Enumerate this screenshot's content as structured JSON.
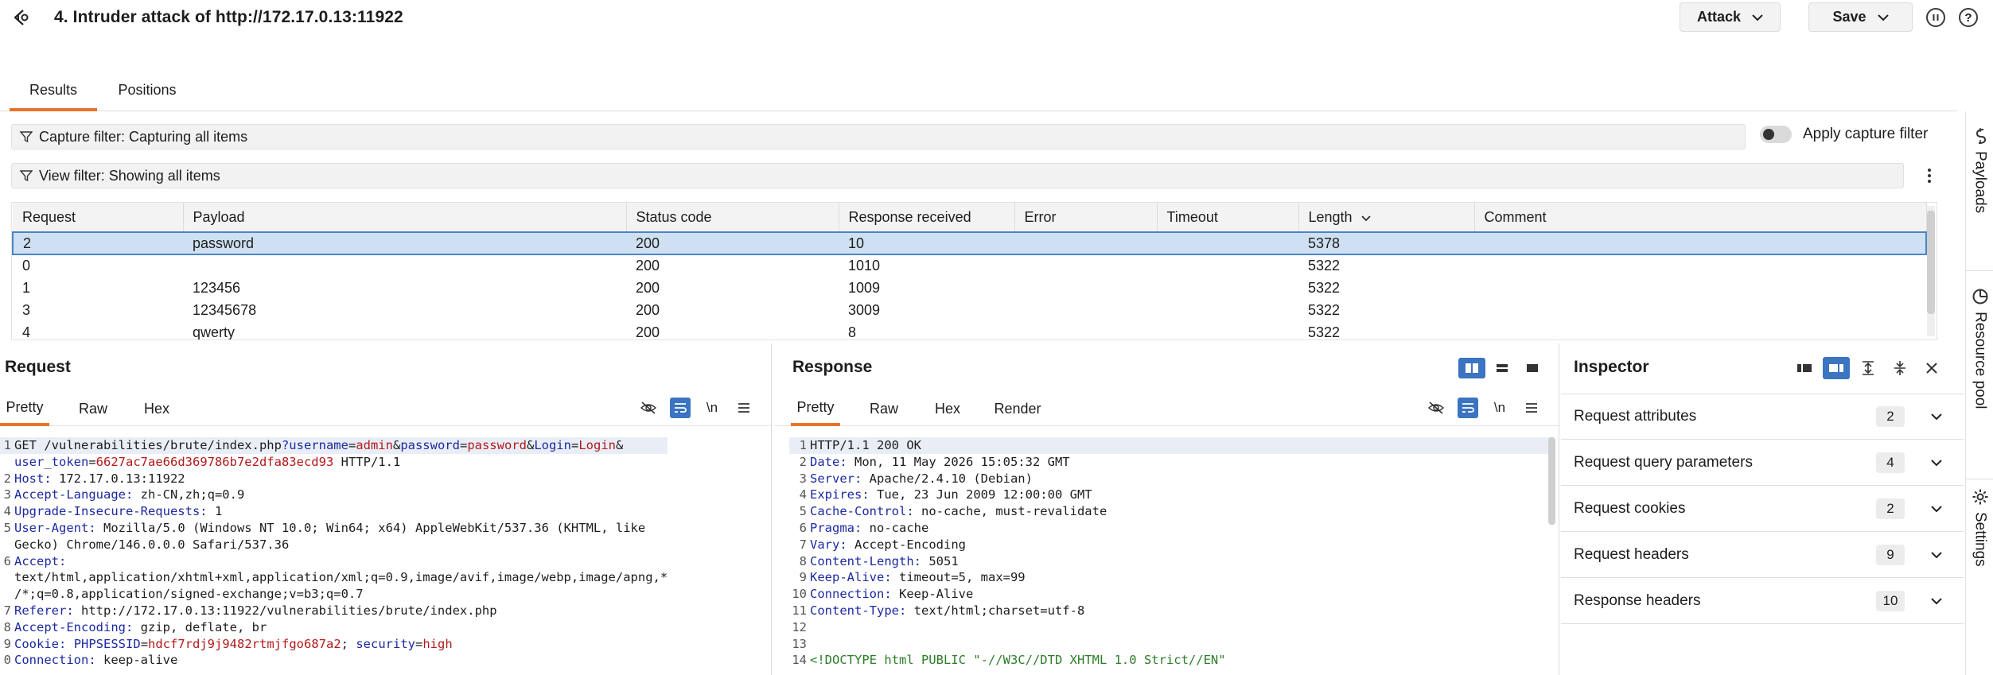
{
  "header": {
    "title": "4. Intruder attack of http://172.17.0.13:11922",
    "attack_label": "Attack",
    "save_label": "Save",
    "help_label": "?"
  },
  "tabs": [
    {
      "label": "Results",
      "active": true
    },
    {
      "label": "Positions",
      "active": false
    }
  ],
  "filters": {
    "capture": "Capture filter: Capturing all items",
    "view": "View filter: Showing all items",
    "apply_capture_label": "Apply capture filter",
    "apply_capture_enabled": false
  },
  "results": {
    "columns": [
      "Request",
      "Payload",
      "Status code",
      "Response received",
      "Error",
      "Timeout",
      "Length",
      "Comment"
    ],
    "sort_column": "Length",
    "rows": [
      {
        "request": "2",
        "payload": "password",
        "status": "200",
        "received": "10",
        "error": "",
        "timeout": "",
        "length": "5378",
        "comment": "",
        "selected": true
      },
      {
        "request": "0",
        "payload": "",
        "status": "200",
        "received": "1010",
        "error": "",
        "timeout": "",
        "length": "5322",
        "comment": ""
      },
      {
        "request": "1",
        "payload": "123456",
        "status": "200",
        "received": "1009",
        "error": "",
        "timeout": "",
        "length": "5322",
        "comment": ""
      },
      {
        "request": "3",
        "payload": "12345678",
        "status": "200",
        "received": "3009",
        "error": "",
        "timeout": "",
        "length": "5322",
        "comment": ""
      },
      {
        "request": "4",
        "payload": "qwerty",
        "status": "200",
        "received": "8",
        "error": "",
        "timeout": "",
        "length": "5322",
        "comment": ""
      }
    ]
  },
  "request_pane": {
    "title": "Request",
    "tabs": [
      "Pretty",
      "Raw",
      "Hex"
    ],
    "newline_label": "\\n",
    "line1": {
      "method_path": "GET /vulnerabilities/brute/index.php",
      "q": "?",
      "p1": "username",
      "eq": "=",
      "v1": "admin",
      "amp": "&",
      "p2": "password",
      "v2": "password",
      "p3": "Login",
      "v3": "Login",
      "p4": "user_token",
      "v4": "6627ac7ae66d369786b7e2dfa83ecd93",
      "proto": " HTTP/1.1"
    },
    "headers": [
      {
        "n": "2",
        "k": "Host",
        "v": " 172.17.0.13:11922"
      },
      {
        "n": "3",
        "k": "Accept-Language",
        "v": " zh-CN,zh;q=0.9"
      },
      {
        "n": "4",
        "k": "Upgrade-Insecure-Requests",
        "v": " 1"
      },
      {
        "n": "5",
        "k": "User-Agent",
        "v": " Mozilla/5.0 (Windows NT 10.0; Win64; x64) AppleWebKit/537.36 (KHTML, like"
      },
      {
        "n": "",
        "k": "",
        "v": "Gecko) Chrome/146.0.0.0 Safari/537.36"
      },
      {
        "n": "6",
        "k": "Accept",
        "v": ""
      },
      {
        "n": "",
        "k": "",
        "v": "text/html,application/xhtml+xml,application/xml;q=0.9,image/avif,image/webp,image/apng,*"
      },
      {
        "n": "",
        "k": "",
        "v": "/*;q=0.8,application/signed-exchange;v=b3;q=0.7"
      },
      {
        "n": "7",
        "k": "Referer",
        "v": " http://172.17.0.13:11922/vulnerabilities/brute/index.php"
      },
      {
        "n": "8",
        "k": "Accept-Encoding",
        "v": " gzip, deflate, br"
      }
    ],
    "cookie": {
      "n": "9",
      "k": "Cookie",
      "c1": "PHPSESSID",
      "v1": "hdcf7rdj9j9482rtmjfgo687a2",
      "sep": "; ",
      "c2": "security",
      "v2": "high"
    },
    "last": {
      "n": "0",
      "k": "Connection",
      "v": " keep-alive"
    }
  },
  "response_pane": {
    "title": "Response",
    "tabs": [
      "Pretty",
      "Raw",
      "Hex",
      "Render"
    ],
    "newline_label": "\\n",
    "status_line": "HTTP/1.1 200 OK",
    "headers": [
      {
        "n": "2",
        "k": "Date",
        "v": " Mon, 11 May 2026 15:05:32 GMT"
      },
      {
        "n": "3",
        "k": "Server",
        "v": " Apache/2.4.10 (Debian)"
      },
      {
        "n": "4",
        "k": "Expires",
        "v": " Tue, 23 Jun 2009 12:00:00 GMT"
      },
      {
        "n": "5",
        "k": "Cache-Control",
        "v": " no-cache, must-revalidate"
      },
      {
        "n": "6",
        "k": "Pragma",
        "v": " no-cache"
      },
      {
        "n": "7",
        "k": "Vary",
        "v": " Accept-Encoding"
      },
      {
        "n": "8",
        "k": "Content-Length",
        "v": " 5051"
      },
      {
        "n": "9",
        "k": "Keep-Alive",
        "v": " timeout=5, max=99"
      },
      {
        "n": "10",
        "k": "Connection",
        "v": " Keep-Alive"
      },
      {
        "n": "11",
        "k": "Content-Type",
        "v": " text/html;charset=utf-8"
      },
      {
        "n": "12",
        "k": "",
        "v": ""
      },
      {
        "n": "13",
        "k": "",
        "v": ""
      }
    ],
    "doctype": {
      "n": "14",
      "v": "<!DOCTYPE html PUBLIC \"-//W3C//DTD XHTML 1.0 Strict//EN\""
    }
  },
  "inspector": {
    "title": "Inspector",
    "rows": [
      {
        "label": "Request attributes",
        "count": "2"
      },
      {
        "label": "Request query parameters",
        "count": "4"
      },
      {
        "label": "Request cookies",
        "count": "2"
      },
      {
        "label": "Request headers",
        "count": "9"
      },
      {
        "label": "Response headers",
        "count": "10"
      }
    ]
  },
  "sidebar": {
    "items": [
      "Payloads",
      "Resource pool",
      "Settings"
    ]
  },
  "colors": {
    "accent": "#e8742b",
    "selection": "#cfe0f2",
    "toggle_on": "#3b74c1"
  }
}
